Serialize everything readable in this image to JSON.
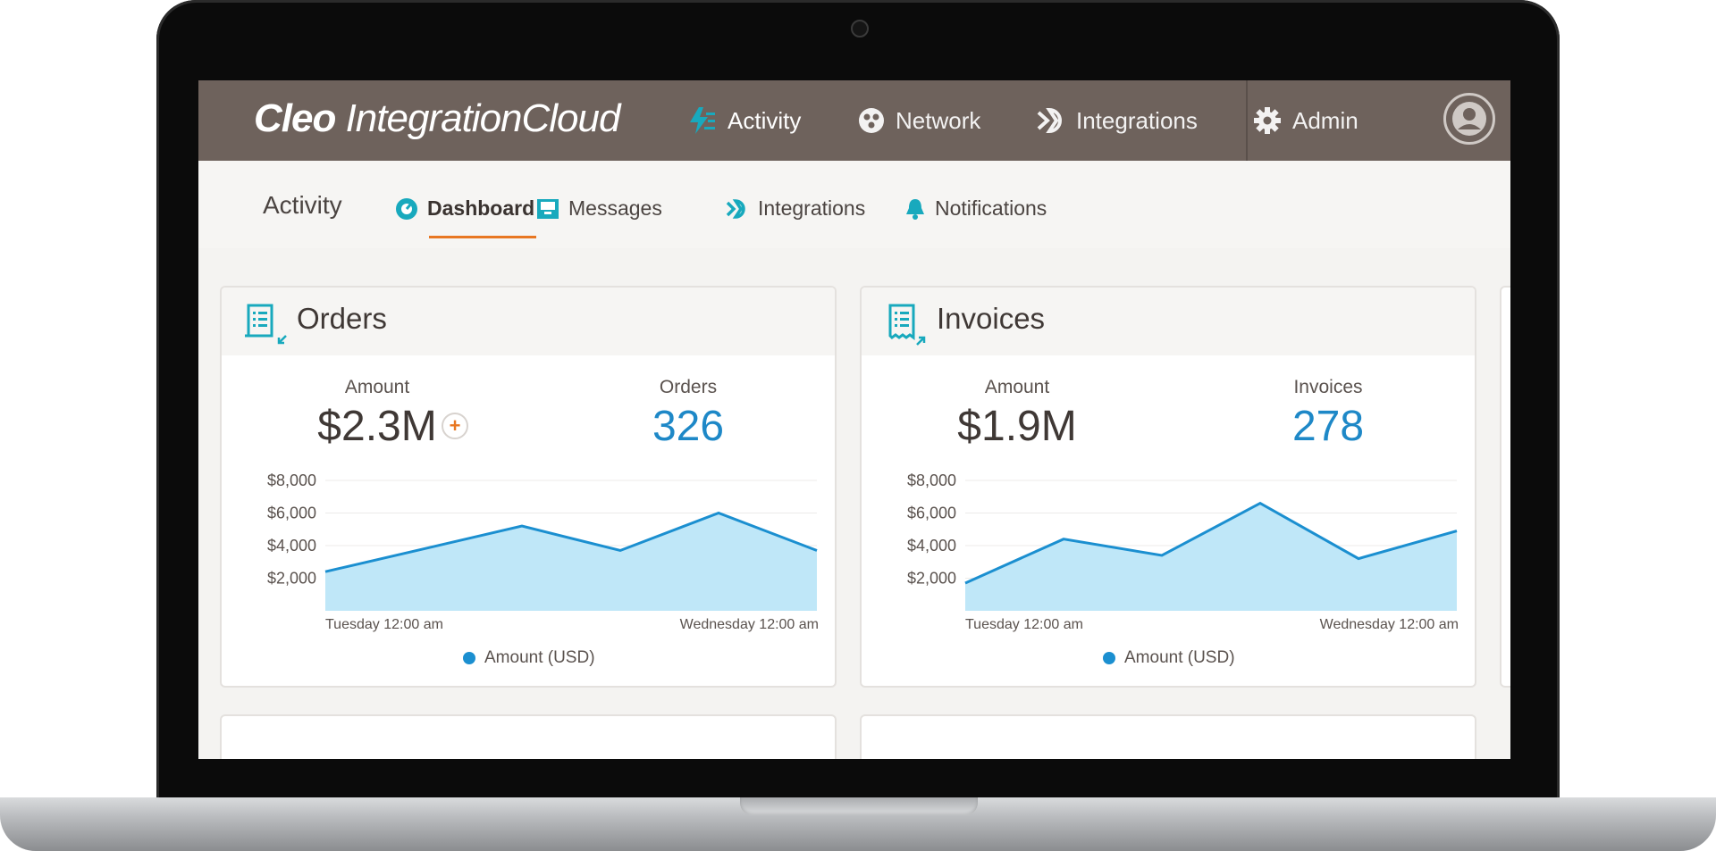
{
  "brand": {
    "bold": "Cleo",
    "rest": " IntegrationCloud"
  },
  "nav": [
    {
      "label": "Activity",
      "icon": "activity-bolt-icon"
    },
    {
      "label": "Network",
      "icon": "network-icon"
    },
    {
      "label": "Integrations",
      "icon": "integrations-icon"
    },
    {
      "label": "Admin",
      "icon": "gear-icon"
    }
  ],
  "subnav": {
    "title": "Activity",
    "tabs": [
      {
        "label": "Dashboard",
        "icon": "dashboard-gauge-icon",
        "active": true
      },
      {
        "label": "Messages",
        "icon": "inbox-icon"
      },
      {
        "label": "Integrations",
        "icon": "integrations-icon"
      },
      {
        "label": "Notifications",
        "icon": "bell-icon"
      }
    ]
  },
  "colors": {
    "topbar": "#6e625c",
    "accent_teal": "#18a9bd",
    "accent_orange": "#e87722",
    "count_blue": "#1e88c7",
    "line": "#1b8fd0",
    "area": "#bfe7f8"
  },
  "cards": [
    {
      "title": "Orders",
      "amount_label": "Amount",
      "amount": "$2.3M",
      "count_label": "Orders",
      "count": "326",
      "plus": "+",
      "legend": "Amount (USD)",
      "chart_data": {
        "type": "area",
        "x": [
          "Tuesday 12:00 am",
          "",
          "",
          "",
          "",
          "Wednesday 12:00 am"
        ],
        "series": [
          {
            "name": "Amount (USD)",
            "values": [
              2400,
              3800,
              5200,
              3700,
              6000,
              3700
            ]
          }
        ],
        "y_ticks": [
          "$8,000",
          "$6,000",
          "$4,000",
          "$2,000"
        ],
        "x_tick_labels": [
          "Tuesday 12:00 am",
          "Wednesday 12:00 am"
        ],
        "ylim": [
          0,
          8000
        ],
        "legend": "bottom-center"
      }
    },
    {
      "title": "Invoices",
      "amount_label": "Amount",
      "amount": "$1.9M",
      "count_label": "Invoices",
      "count": "278",
      "legend": "Amount (USD)",
      "chart_data": {
        "type": "area",
        "x": [
          "Tuesday 12:00 am",
          "",
          "",
          "",
          "",
          "",
          "Wednesday 12:00 am"
        ],
        "series": [
          {
            "name": "Amount (USD)",
            "values": [
              1700,
              4400,
              3400,
              6600,
              3200,
              4900
            ]
          }
        ],
        "y_ticks": [
          "$8,000",
          "$6,000",
          "$4,000",
          "$2,000"
        ],
        "x_tick_labels": [
          "Tuesday 12:00 am",
          "Wednesday 12:00 am"
        ],
        "ylim": [
          0,
          8000
        ],
        "legend": "bottom-center"
      }
    }
  ]
}
